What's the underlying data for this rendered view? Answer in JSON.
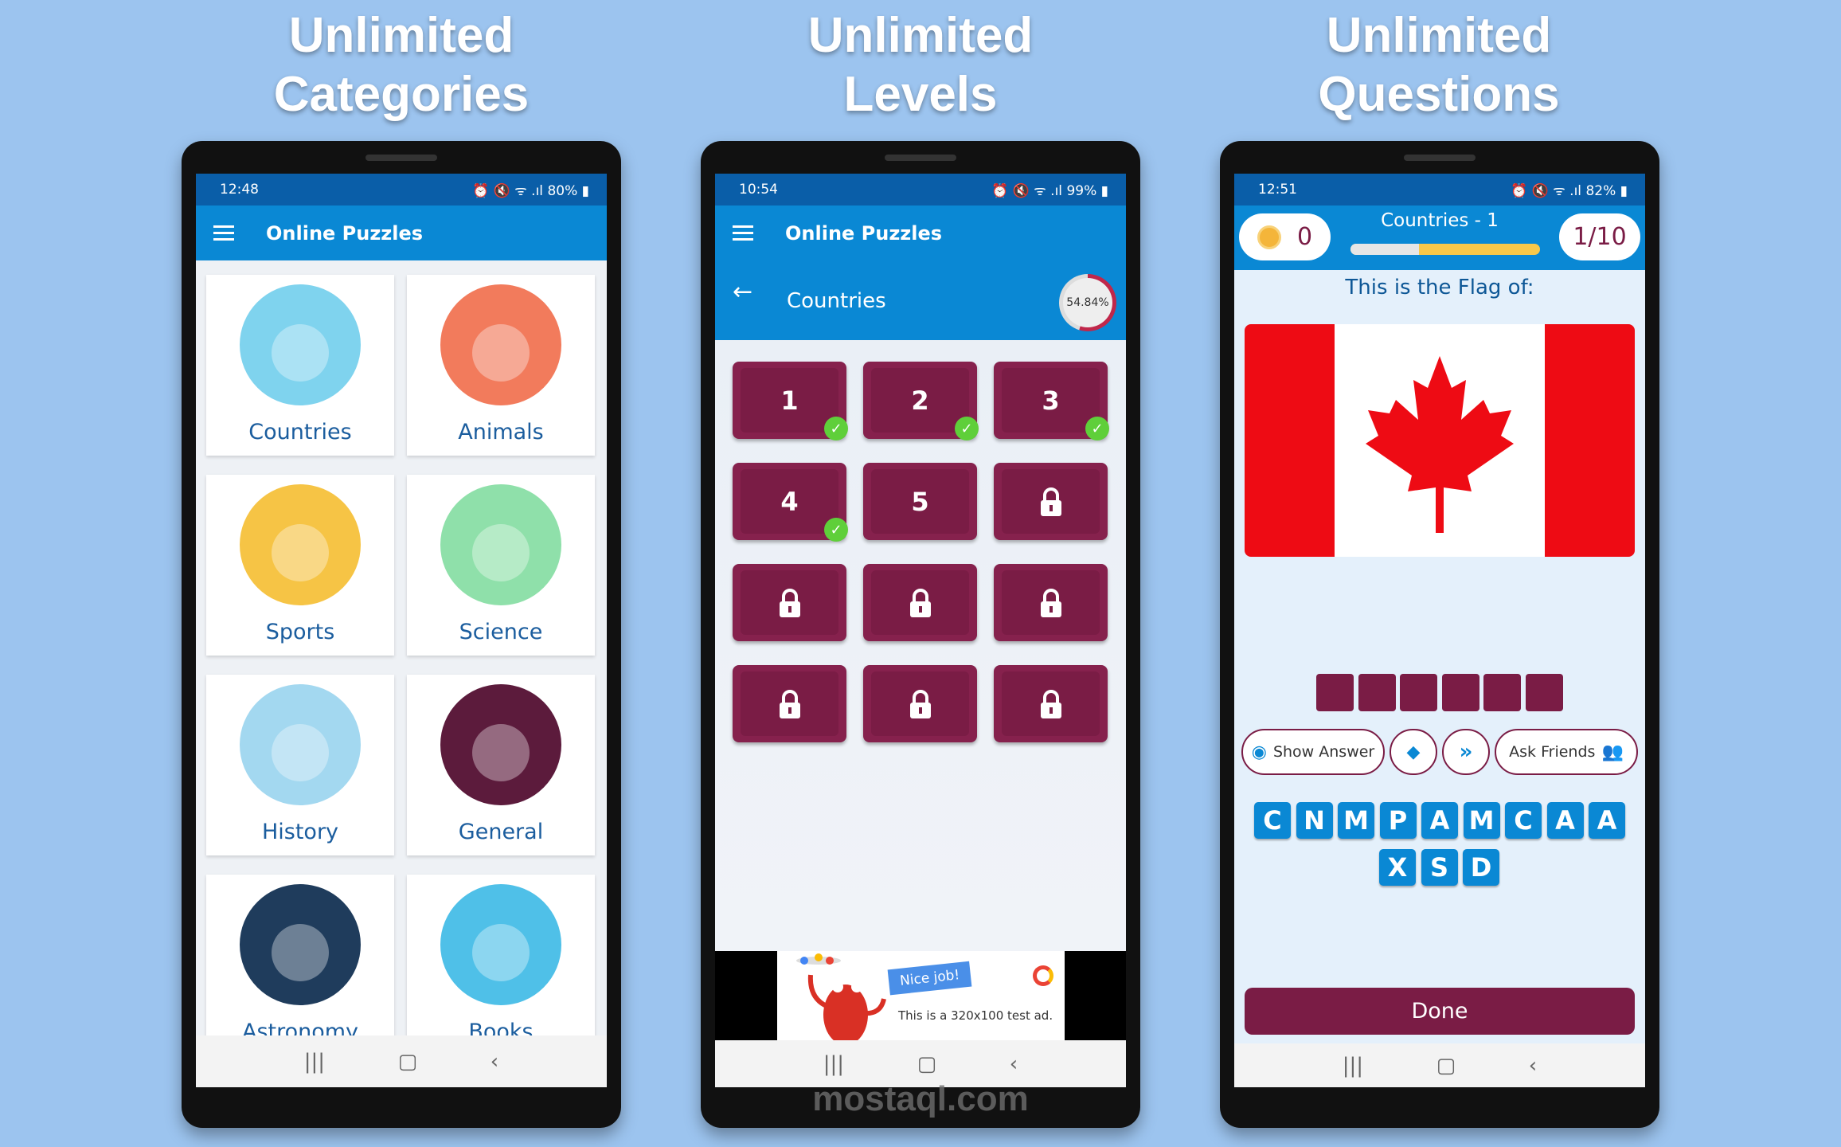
{
  "headlines": [
    {
      "line1": "Unlimited",
      "line2": "Categories"
    },
    {
      "line1": "Unlimited",
      "line2": "Levels"
    },
    {
      "line1": "Unlimited",
      "line2": "Questions"
    }
  ],
  "phones": [
    {
      "time": "12:48",
      "battery": "80%"
    },
    {
      "time": "10:54",
      "battery": "99%"
    },
    {
      "time": "12:51",
      "battery": "82%"
    }
  ],
  "app_title": "Online Puzzles",
  "categories": [
    {
      "label": "Countries",
      "icon": "globe-icon",
      "color": "#7fd3ee"
    },
    {
      "label": "Animals",
      "icon": "deer-icon",
      "color": "#f27b5c"
    },
    {
      "label": "Sports",
      "icon": "soccer-icon",
      "color": "#f6c445"
    },
    {
      "label": "Science",
      "icon": "atom-icon",
      "color": "#8fe0aa"
    },
    {
      "label": "History",
      "icon": "castle-icon",
      "color": "#a3d8f0"
    },
    {
      "label": "General",
      "icon": "question-icon",
      "color": "#5c1b3c"
    },
    {
      "label": "Astronomy",
      "icon": "planet-icon",
      "color": "#1f3c5c"
    },
    {
      "label": "Books",
      "icon": "books-icon",
      "color": "#4fc0e8"
    }
  ],
  "levels": {
    "category": "Countries",
    "progress": "54.84%",
    "progress_value": 54.84,
    "items": [
      {
        "n": "1",
        "state": "done"
      },
      {
        "n": "2",
        "state": "done"
      },
      {
        "n": "3",
        "state": "done"
      },
      {
        "n": "4",
        "state": "done"
      },
      {
        "n": "5",
        "state": "open"
      },
      {
        "n": "",
        "state": "locked"
      },
      {
        "n": "",
        "state": "locked"
      },
      {
        "n": "",
        "state": "locked"
      },
      {
        "n": "",
        "state": "locked"
      },
      {
        "n": "",
        "state": "locked"
      },
      {
        "n": "",
        "state": "locked"
      },
      {
        "n": "",
        "state": "locked"
      }
    ],
    "ad": {
      "banner": "Nice job!",
      "text": "This is a 320x100 test ad."
    }
  },
  "quiz": {
    "score": "0",
    "title": "Countries - 1",
    "progress_fraction": 0.36,
    "counter": "1/10",
    "question": "This is the Flag of:",
    "answer_slots": 6,
    "show_answer": "Show Answer",
    "ask_friends": "Ask Friends",
    "letters_row1": [
      "C",
      "N",
      "M",
      "P",
      "A",
      "M",
      "C",
      "A",
      "A"
    ],
    "letters_row2": [
      "X",
      "S",
      "D"
    ],
    "done": "Done"
  },
  "watermark": "mostaql.com",
  "colors": {
    "primary": "#0a88d4",
    "status": "#0a5ea8",
    "accent": "#7a1c45",
    "success": "#5fcf3a"
  }
}
